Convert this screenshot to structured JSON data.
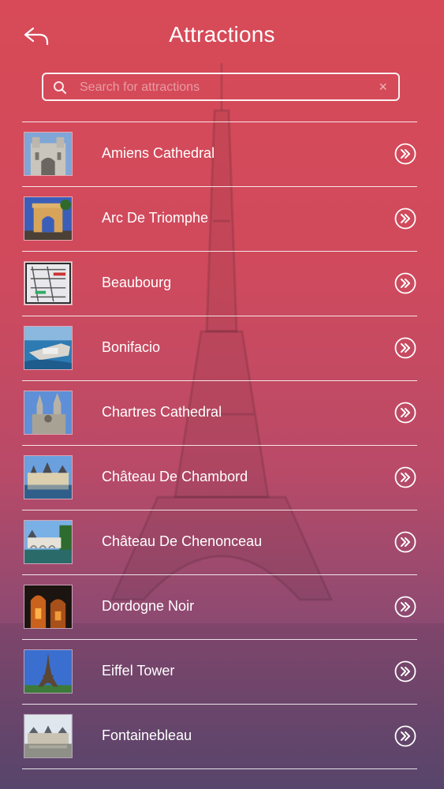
{
  "header": {
    "title": "Attractions",
    "back_icon": "back-arrow-icon"
  },
  "search": {
    "placeholder": "Search for attractions",
    "value": "",
    "clear_label": "×"
  },
  "items": [
    {
      "label": "Amiens Cathedral"
    },
    {
      "label": "Arc De Triomphe"
    },
    {
      "label": "Beaubourg"
    },
    {
      "label": "Bonifacio"
    },
    {
      "label": "Chartres Cathedral"
    },
    {
      "label": "Château De Chambord"
    },
    {
      "label": "Château De Chenonceau"
    },
    {
      "label": "Dordogne Noir"
    },
    {
      "label": "Eiffel Tower"
    },
    {
      "label": "Fontainebleau"
    }
  ],
  "colors": {
    "gradient_top": "#d84a57",
    "gradient_bottom": "#5e4a72",
    "text": "#ffffff"
  }
}
